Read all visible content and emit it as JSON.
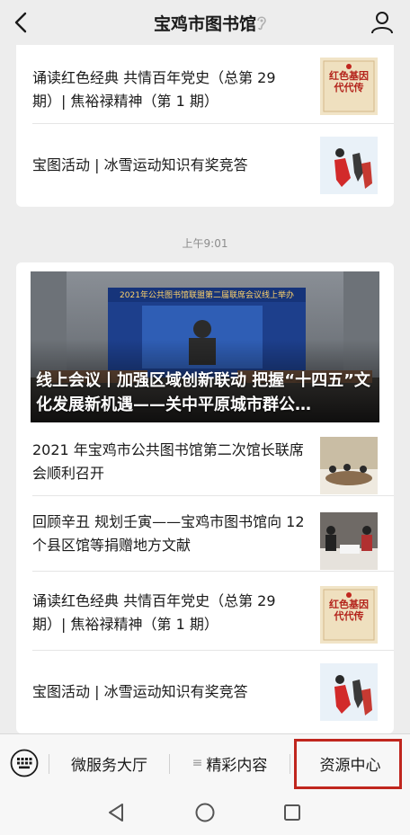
{
  "header": {
    "title": "宝鸡市图书馆",
    "icons": {
      "back": "back-arrow-icon",
      "earpiece": "earpiece-icon",
      "profile": "person-icon"
    }
  },
  "card_top": {
    "items": [
      {
        "text": "诵读红色经典 共情百年党史（总第 29 期）| 焦裕禄精神（第 1 期）",
        "thumb_text": "红色基因代代传"
      },
      {
        "text": "宝图活动 | 冰雪运动知识有奖竞答"
      }
    ]
  },
  "timestamp": "上午9:01",
  "card_main": {
    "hero": {
      "caption": "线上会议丨加强区域创新联动 把握“十四五”文化发展新机遇——关中平原城市群公…",
      "banner_text": "2021年公共图书馆联盟第二届联席会议线上举办"
    },
    "items": [
      {
        "text": "2021 年宝鸡市公共图书馆第二次馆长联席会顺利召开"
      },
      {
        "text": "回顾辛丑 规划壬寅——宝鸡市图书馆向 12 个县区馆等捐赠地方文献"
      },
      {
        "text": "诵读红色经典 共情百年党史（总第 29 期）| 焦裕禄精神（第 1 期）",
        "thumb_text": "红色基因代代传"
      },
      {
        "text": "宝图活动 | 冰雪运动知识有奖竞答"
      }
    ]
  },
  "bottom_menu": {
    "keyboard_icon": "keyboard-icon",
    "items": [
      "微服务大厅",
      "精彩内容",
      "资源中心"
    ],
    "highlight_color": "#c0261e"
  },
  "system_nav": {
    "icons": [
      "back-triangle-icon",
      "home-circle-icon",
      "recents-square-icon"
    ]
  }
}
